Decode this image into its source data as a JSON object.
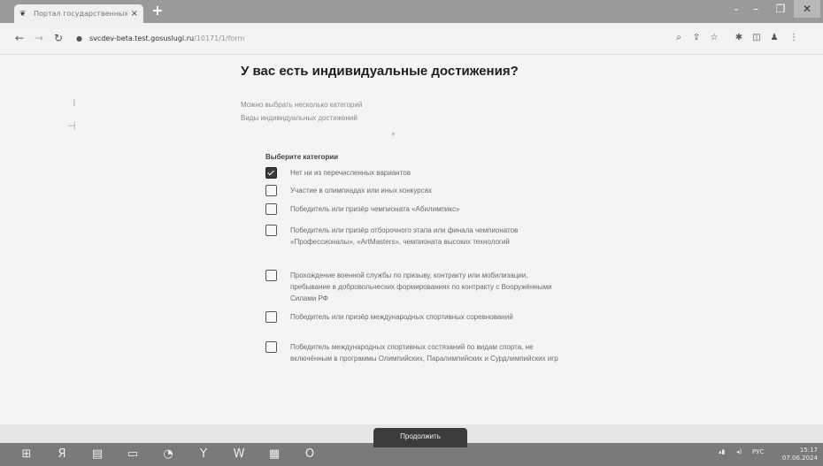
{
  "browser": {
    "tab_title": "Портал государственных услуг",
    "tab_close": "×",
    "new_tab": "+",
    "url_host": "svcdev-beta.test.gosuslugi.ru",
    "url_path": "/10171/1/form",
    "window_controls": {
      "caret": "⌄",
      "minimize": "–",
      "maximize": "❐",
      "close": "✕"
    }
  },
  "page": {
    "title": "У вас есть индивидуальные достижения?",
    "hint_multiple": "Можно выбрать несколько категорий",
    "hint_types": "Виды индивидуальных достижений",
    "section_label": "Выберите категории",
    "options": [
      {
        "label": "Нет ни из перечисленных вариантов",
        "checked": true
      },
      {
        "label": "Участие в олимпиадах или иных конкурсах",
        "checked": false
      },
      {
        "label": "Победитель или призёр чемпионата «Абилимпикс»",
        "checked": false
      },
      {
        "label": "Победитель или призёр отборочного этапа или финала чемпионатов «Профессионалы», «ArtMasters», чемпионата высоких технологий",
        "checked": false
      },
      {
        "label": "Прохождение военной службы по призыву, контракту или мобилизации, пребывание в добровольческих формированиях по контракту с Вооружёнными Силами РФ",
        "checked": false
      },
      {
        "label": "Победитель или призёр международных спортивных соревнований",
        "checked": false
      },
      {
        "label": "Победитель международных спортивных состязаний по видам спорта, не включённым в программы Олимпийских, Паралимпийских и Сурдлимпийских игр",
        "checked": false
      }
    ],
    "continue_label": "Продолжить"
  },
  "taskbar": {
    "apps": [
      "start-icon",
      "yandex-icon",
      "explorer-icon",
      "folder-icon",
      "chrome-icon",
      "yandex-browser-icon",
      "word-icon",
      "app-icon",
      "opera-icon"
    ],
    "lang": "РУС",
    "time": "15:17",
    "date": "07.06.2024"
  }
}
